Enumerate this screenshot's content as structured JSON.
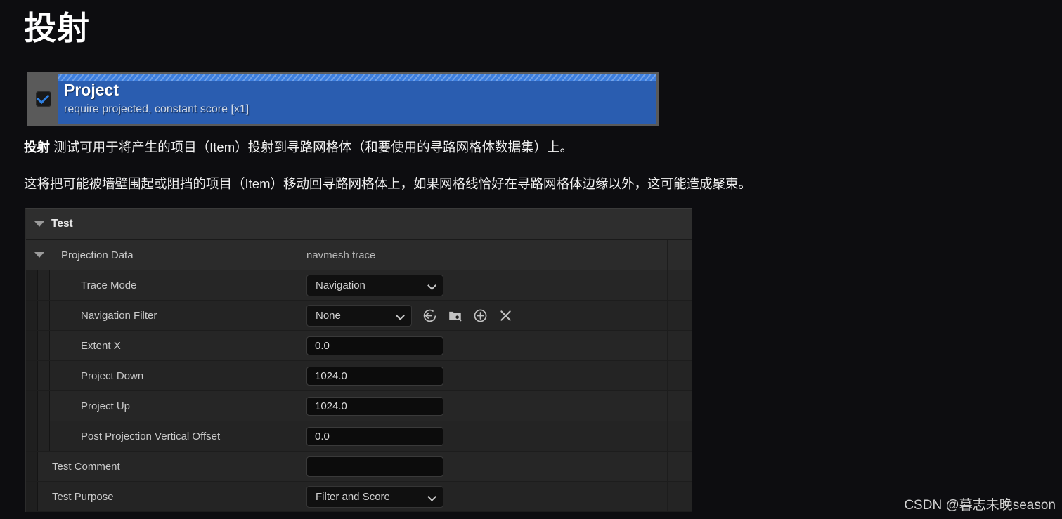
{
  "page": {
    "title": "投射",
    "background_color": "#0d0d10"
  },
  "node_card": {
    "checkbox_checked": true,
    "checkbox_icon": "check-icon",
    "title": "Project",
    "subtitle": "require projected, constant score [x1]",
    "accent_color": "#2a5db0",
    "stripe_color": "#3d7fe0"
  },
  "prose": {
    "paragraph_1_lead": "投射",
    "paragraph_1_rest": " 测试可用于将产生的项目（Item）投射到寻路网格体（和要使用的寻路网格体数据集）上。",
    "paragraph_2": "这将把可能被墙壁围起或阻挡的项目（Item）移动回寻路网格体上，如果网格线恰好在寻路网格体边缘以外，这可能造成聚束。"
  },
  "details_panel": {
    "rows": [
      {
        "kind": "category",
        "label": "Test",
        "twisty": "chevron-down-icon",
        "value_type": "none",
        "value": ""
      },
      {
        "kind": "subcategory",
        "label": "Projection Data",
        "twisty": "chevron-down-icon",
        "value_type": "text",
        "value": "navmesh trace"
      },
      {
        "kind": "property",
        "label": "Trace Mode",
        "value_type": "combo",
        "value": "Navigation"
      },
      {
        "kind": "property",
        "label": "Navigation Filter",
        "value_type": "combo_with_icons",
        "value": "None",
        "icons": [
          "use-selected-asset-icon",
          "browse-to-asset-icon",
          "new-asset-icon",
          "clear-asset-icon"
        ]
      },
      {
        "kind": "property",
        "label": "Extent X",
        "value_type": "number",
        "value": "0.0"
      },
      {
        "kind": "property",
        "label": "Project Down",
        "value_type": "number",
        "value": "1024.0"
      },
      {
        "kind": "property",
        "label": "Project Up",
        "value_type": "number",
        "value": "1024.0"
      },
      {
        "kind": "property",
        "label": "Post Projection Vertical Offset",
        "value_type": "number",
        "value": "0.0"
      },
      {
        "kind": "property_top",
        "label": "Test Comment",
        "value_type": "textbox",
        "value": ""
      },
      {
        "kind": "property_top",
        "label": "Test Purpose",
        "value_type": "combo",
        "value": "Filter and Score"
      }
    ]
  },
  "watermark": {
    "text": "CSDN @暮志未晚season"
  }
}
